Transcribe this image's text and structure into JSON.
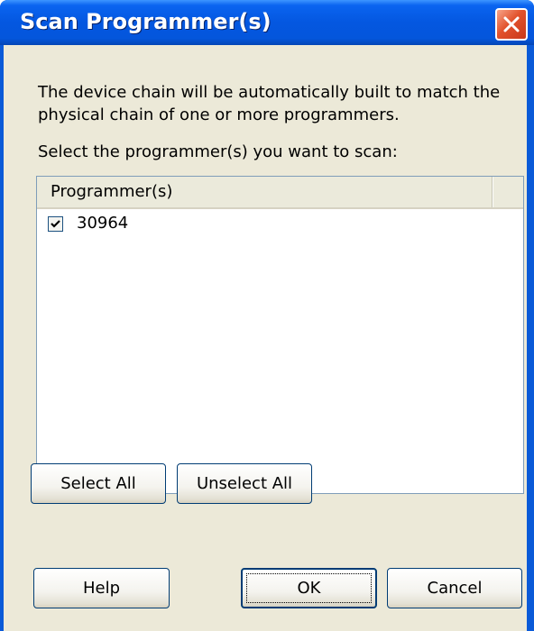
{
  "window": {
    "title": "Scan Programmer(s)",
    "close_icon": "close-icon"
  },
  "description": {
    "line1": "The device chain will be automatically built to match the",
    "line2": "physical chain of one or more programmers."
  },
  "prompt": "Select the programmer(s) you want to scan:",
  "list": {
    "column_header": "Programmer(s)",
    "rows": [
      {
        "label": "30964",
        "checked": true
      }
    ]
  },
  "buttons": {
    "select_all": "Select All",
    "unselect_all": "Unselect All",
    "help": "Help",
    "ok": "OK",
    "cancel": "Cancel"
  },
  "colors": {
    "titlebar": "#0457e0",
    "client_bg": "#ece9d8",
    "close_button": "#e2522c"
  }
}
